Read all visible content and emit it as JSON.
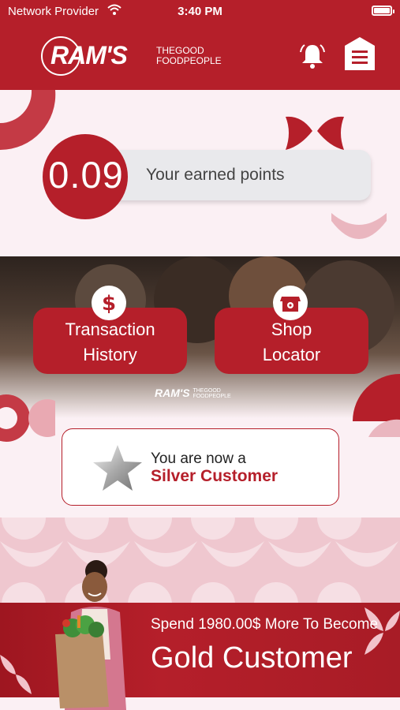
{
  "status_bar": {
    "carrier": "Network Provider",
    "time": "3:40 PM"
  },
  "header": {
    "logo_text": "RAM'S",
    "tagline_line1": "THEGOOD",
    "tagline_line2": "FOODPEOPLE",
    "bell_icon": "bell-icon",
    "menu_icon": "menu-icon"
  },
  "points": {
    "value": "0.09",
    "label": "Your earned points"
  },
  "actions": [
    {
      "label_line1": "Transaction",
      "label_line2": "History",
      "icon": "dollar-icon"
    },
    {
      "label_line1": "Shop",
      "label_line2": "Locator",
      "icon": "store-locator-icon"
    }
  ],
  "watermark": {
    "brand": "RAM'S",
    "line1": "THEGOOD",
    "line2": "FOODPEOPLE"
  },
  "status": {
    "line1": "You are now a",
    "line2": "Silver Customer",
    "icon": "silver-star-icon"
  },
  "promo": {
    "line1": "Spend 1980.00$ More To Become",
    "line2": "Gold Customer"
  },
  "colors": {
    "brand_red": "#b51f2a",
    "background": "#fbf0f4"
  }
}
